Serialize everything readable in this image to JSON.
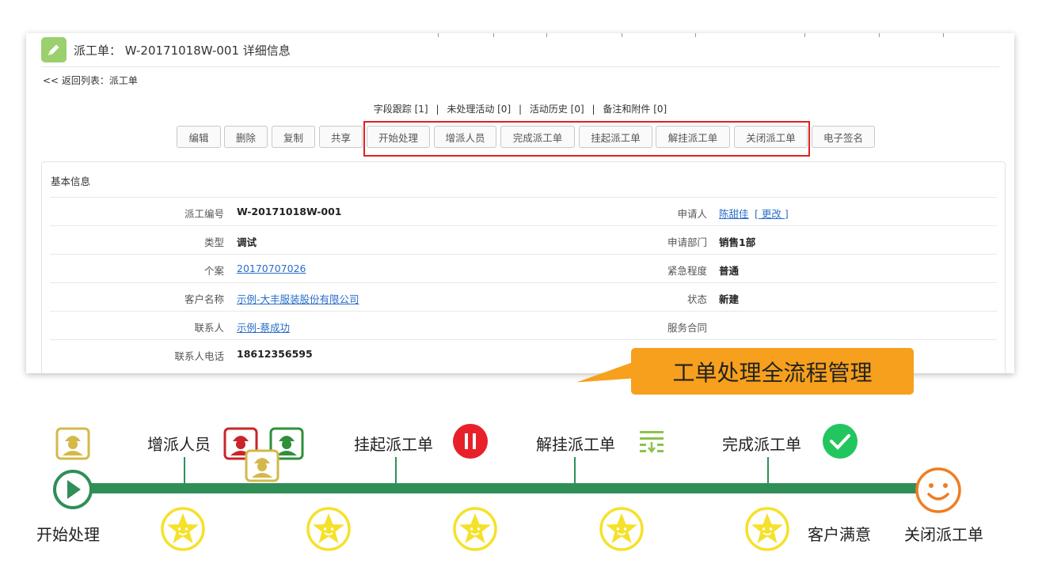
{
  "header": {
    "title": "派工单： W-20171018W-001  详细信息",
    "back_link": "<< 返回列表：派工单"
  },
  "related_links": [
    "字段跟踪 [1]",
    "未处理活动 [0]",
    "活动历史 [0]",
    "备注和附件 [0]"
  ],
  "related_sep": "|",
  "buttons": {
    "edit": "编辑",
    "delete": "删除",
    "copy": "复制",
    "share": "共享",
    "start": "开始处理",
    "add_staff": "增派人员",
    "complete": "完成派工单",
    "suspend": "挂起派工单",
    "resume": "解挂派工单",
    "close": "关闭派工单",
    "esign": "电子签名"
  },
  "section": {
    "title": "基本信息",
    "rows": [
      {
        "left_label": "派工编号",
        "left_value": "W-20171018W-001",
        "right_label": "申请人",
        "right_value": "陈甜佳",
        "right_extra": "[ 更改 ]"
      },
      {
        "left_label": "类型",
        "left_value": "调试",
        "right_label": "申请部门",
        "right_value": "销售1部"
      },
      {
        "left_label": "个案",
        "left_value": "20170707026",
        "right_label": "紧急程度",
        "right_value": "普通"
      },
      {
        "left_label": "客户名称",
        "left_value": "示例-大丰服装股份有限公司",
        "right_label": "状态",
        "right_value": "新建"
      },
      {
        "left_label": "联系人",
        "left_value": "示例-蔡成功",
        "right_label": "服务合同",
        "right_value": ""
      },
      {
        "left_label": "联系人电话",
        "left_value": "18612356595"
      }
    ]
  },
  "callout": "工单处理全流程管理",
  "timeline": {
    "start": "开始处理",
    "add_staff": "增派人员",
    "suspend": "挂起派工单",
    "resume": "解挂派工单",
    "complete": "完成派工单",
    "satisfaction": "客户满意",
    "close": "关闭派工单"
  },
  "colors": {
    "accent_green": "#2f8f56",
    "callout_orange": "#f7a01d",
    "highlight_red": "#e02020",
    "link_blue": "#2a6dc8",
    "star_yellow": "#f5e12a",
    "smile_orange": "#ef7d22"
  }
}
